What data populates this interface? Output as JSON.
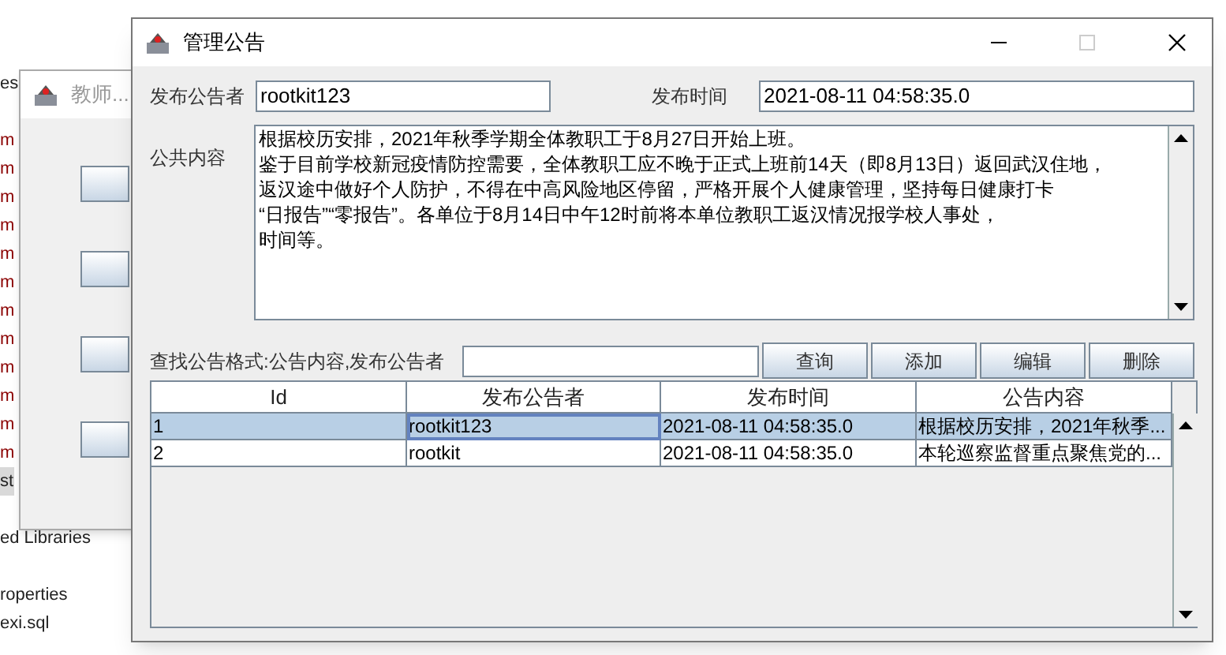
{
  "background": {
    "tree_items": [
      {
        "text": "es",
        "selected": false
      },
      {
        "text": "m",
        "selected": false
      },
      {
        "text": "m",
        "selected": false
      },
      {
        "text": "m",
        "selected": false
      },
      {
        "text": "m",
        "selected": false
      },
      {
        "text": "m",
        "selected": false
      },
      {
        "text": "m",
        "selected": false
      },
      {
        "text": "m",
        "selected": false
      },
      {
        "text": "m",
        "selected": false
      },
      {
        "text": "m",
        "selected": false
      },
      {
        "text": "m",
        "selected": false
      },
      {
        "text": "m",
        "selected": false
      },
      {
        "text": "m",
        "selected": false
      },
      {
        "text": "st",
        "selected": true
      },
      {
        "text": "ed Libraries",
        "selected": false
      },
      {
        "text": "roperties",
        "selected": false
      },
      {
        "text": "exi.sql",
        "selected": false
      }
    ]
  },
  "back_window": {
    "title": "教师..."
  },
  "dialog": {
    "title": "管理公告",
    "publisher": {
      "label": "发布公告者",
      "value": "rootkit123"
    },
    "time": {
      "label": "发布时间",
      "value": "2021-08-11 04:58:35.0"
    },
    "content": {
      "label": "公共内容",
      "lines": [
        "根据校历安排，2021年秋季学期全体教职工于8月27日开始上班。",
        "鉴于目前学校新冠疫情防控需要，全体教职工应不晚于正式上班前14天（即8月13日）返回武汉住地，",
        "返汉途中做好个人防护，不得在中高风险地区停留，严格开展个人健康管理，坚持每日健康打卡",
        "“日报告”“零报告”。各单位于8月14日中午12时前将本单位教职工返汉情况报学校人事处，",
        "时间等。"
      ]
    },
    "search": {
      "label": "查找公告格式:公告内容,发布公告者"
    },
    "buttons": [
      "查询",
      "添加",
      "编辑",
      "删除"
    ],
    "table": {
      "columns": [
        "Id",
        "发布公告者",
        "发布时间",
        "公告内容"
      ],
      "rows": [
        {
          "cells": [
            "1",
            "rootkit123",
            "2021-08-11 04:58:35.0",
            "根据校历安排，2021年秋季..."
          ],
          "selected": true
        },
        {
          "cells": [
            "2",
            "rootkit",
            "2021-08-11 04:58:35.0",
            "本轮巡察监督重点聚焦党的..."
          ],
          "selected": false
        }
      ]
    }
  }
}
